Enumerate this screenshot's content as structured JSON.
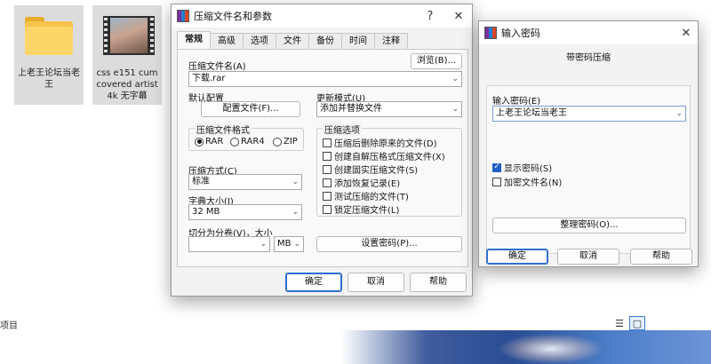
{
  "explorer": {
    "files": [
      {
        "caption": "上老王论坛当老王",
        "icon": "folder-icon"
      },
      {
        "caption": "css e151 cum covered artist 4k 无字幕",
        "icon": "video-thumbnail"
      }
    ],
    "status_left": "项目"
  },
  "archive_dialog": {
    "title": "压缩文件名和参数",
    "title_buttons": {
      "help": "?",
      "close": "✕"
    },
    "tabs": [
      "常规",
      "高级",
      "选项",
      "文件",
      "备份",
      "时间",
      "注释"
    ],
    "active_tab": "常规",
    "archive_name_label": "压缩文件名(A)",
    "archive_name_value": "下载.rar",
    "browse_label": "浏览(B)...",
    "default_profile_label": "默认配置",
    "profiles_button": "配置文件(F)...",
    "update_mode_label": "更新模式(U)",
    "update_mode_value": "添加并替换文件",
    "format_group_label": "压缩文件格式",
    "formats": [
      "RAR",
      "RAR4",
      "ZIP"
    ],
    "selected_format": "RAR",
    "method_label": "压缩方式(C)",
    "method_value": "标准",
    "dict_label": "字典大小(I)",
    "dict_value": "32 MB",
    "split_label": "切分为分卷(V)，大小",
    "split_value": "",
    "split_unit": "MB",
    "options_group_label": "压缩选项",
    "options": [
      {
        "label": "压缩后删除原来的文件(D)",
        "checked": false
      },
      {
        "label": "创建自解压格式压缩文件(X)",
        "checked": false
      },
      {
        "label": "创建固实压缩文件(S)",
        "checked": false
      },
      {
        "label": "添加恢复记录(E)",
        "checked": false
      },
      {
        "label": "测试压缩的文件(T)",
        "checked": false
      },
      {
        "label": "锁定压缩文件(L)",
        "checked": false
      }
    ],
    "set_password_button": "设置密码(P)...",
    "ok": "确定",
    "cancel": "取消",
    "help": "帮助"
  },
  "password_dialog": {
    "title": "输入密码",
    "close": "✕",
    "heading": "带密码压缩",
    "password_label": "输入密码(E)",
    "password_value": "上老王论坛当老王",
    "show_password_label": "显示密码(S)",
    "show_password_checked": true,
    "encrypt_names_label": "加密文件名(N)",
    "encrypt_names_checked": false,
    "organize_button": "整理密码(O)...",
    "ok": "确定",
    "cancel": "取消",
    "help": "帮助"
  },
  "colors": {
    "accent": "#1f5fc4",
    "dialog_bg": "#f3f3f3",
    "folder": "#f7c34d"
  }
}
